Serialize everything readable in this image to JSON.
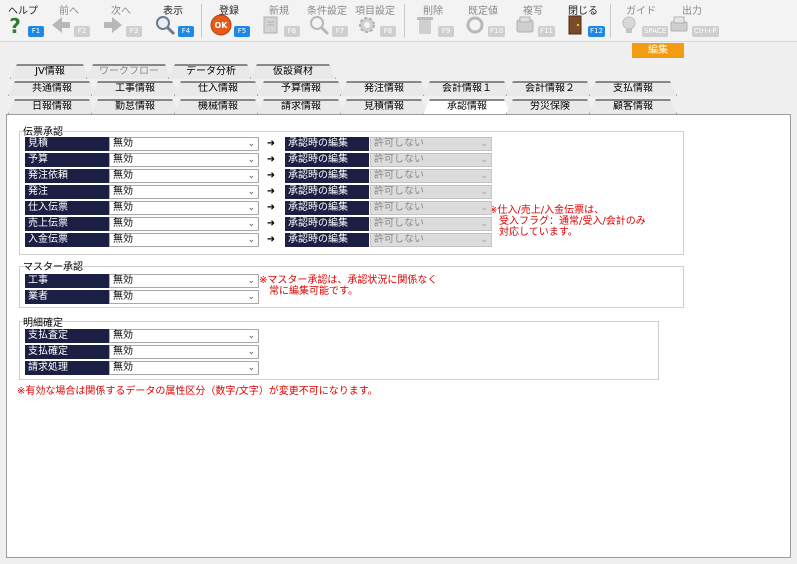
{
  "toolbar": {
    "help": {
      "label": "ヘルプ",
      "key": "F1"
    },
    "prev": {
      "label": "前へ",
      "key": "F2"
    },
    "next": {
      "label": "次へ",
      "key": "F3"
    },
    "show": {
      "label": "表示",
      "key": "F4"
    },
    "register": {
      "label": "登録",
      "key": "F5"
    },
    "new": {
      "label": "新規",
      "key": "F6"
    },
    "conditions": {
      "label": "条件設定",
      "key": "F7"
    },
    "itemsettings": {
      "label": "項目設定",
      "key": "F8"
    },
    "delete": {
      "label": "削除",
      "key": "F9"
    },
    "defaults": {
      "label": "既定値",
      "key": "F10"
    },
    "copy": {
      "label": "複写",
      "key": "F11"
    },
    "close": {
      "label": "閉じる",
      "key": "F12"
    },
    "guide": {
      "label": "ガイド",
      "key": "SPACE"
    },
    "output": {
      "label": "出力",
      "key": "Ctrl+P"
    }
  },
  "edit_badge": "編集",
  "tabs_row1": [
    "JV情報",
    "ワークフロー",
    "データ分析",
    "仮設資材"
  ],
  "tabs_row2": [
    "共通情報",
    "工事情報",
    "仕入情報",
    "予算情報",
    "発注情報",
    "会計情報１",
    "会計情報２",
    "支払情報"
  ],
  "tabs_row3": [
    "日報情報",
    "勤怠情報",
    "機械情報",
    "請求情報",
    "見積情報",
    "承認情報",
    "労災保険",
    "顧客情報"
  ],
  "slip": {
    "title": "伝票承認",
    "rows": [
      {
        "label": "見積",
        "value": "無効",
        "edit_label": "承認時の編集",
        "edit_value": "許可しない"
      },
      {
        "label": "予算",
        "value": "無効",
        "edit_label": "承認時の編集",
        "edit_value": "許可しない"
      },
      {
        "label": "発注依頼",
        "value": "無効",
        "edit_label": "承認時の編集",
        "edit_value": "許可しない"
      },
      {
        "label": "発注",
        "value": "無効",
        "edit_label": "承認時の編集",
        "edit_value": "許可しない"
      },
      {
        "label": "仕入伝票",
        "value": "無効",
        "edit_label": "承認時の編集",
        "edit_value": "許可しない"
      },
      {
        "label": "売上伝票",
        "value": "無効",
        "edit_label": "承認時の編集",
        "edit_value": "許可しない"
      },
      {
        "label": "入金伝票",
        "value": "無効",
        "edit_label": "承認時の編集",
        "edit_value": "許可しない"
      }
    ],
    "note": "※仕入/売上/入金伝票は、\n　受入フラグ：通常/受入/会計のみ\n　対応しています。"
  },
  "master": {
    "title": "マスター承認",
    "rows": [
      {
        "label": "工事",
        "value": "無効"
      },
      {
        "label": "業者",
        "value": "無効"
      }
    ],
    "note": "※マスター承認は、承認状況に関係なく\n　常に編集可能です。"
  },
  "detail": {
    "title": "明細確定",
    "rows": [
      {
        "label": "支払査定",
        "value": "無効"
      },
      {
        "label": "支払確定",
        "value": "無効"
      },
      {
        "label": "請求処理",
        "value": "無効"
      }
    ]
  },
  "footer_note": "※有効な場合は関係するデータの属性区分（数字/文字）が変更不可になります。",
  "colors": {
    "label_bg": "#1b1f44",
    "note": "#e00000",
    "edit_badge": "#f39c12",
    "fkey": "#1e88e5"
  }
}
